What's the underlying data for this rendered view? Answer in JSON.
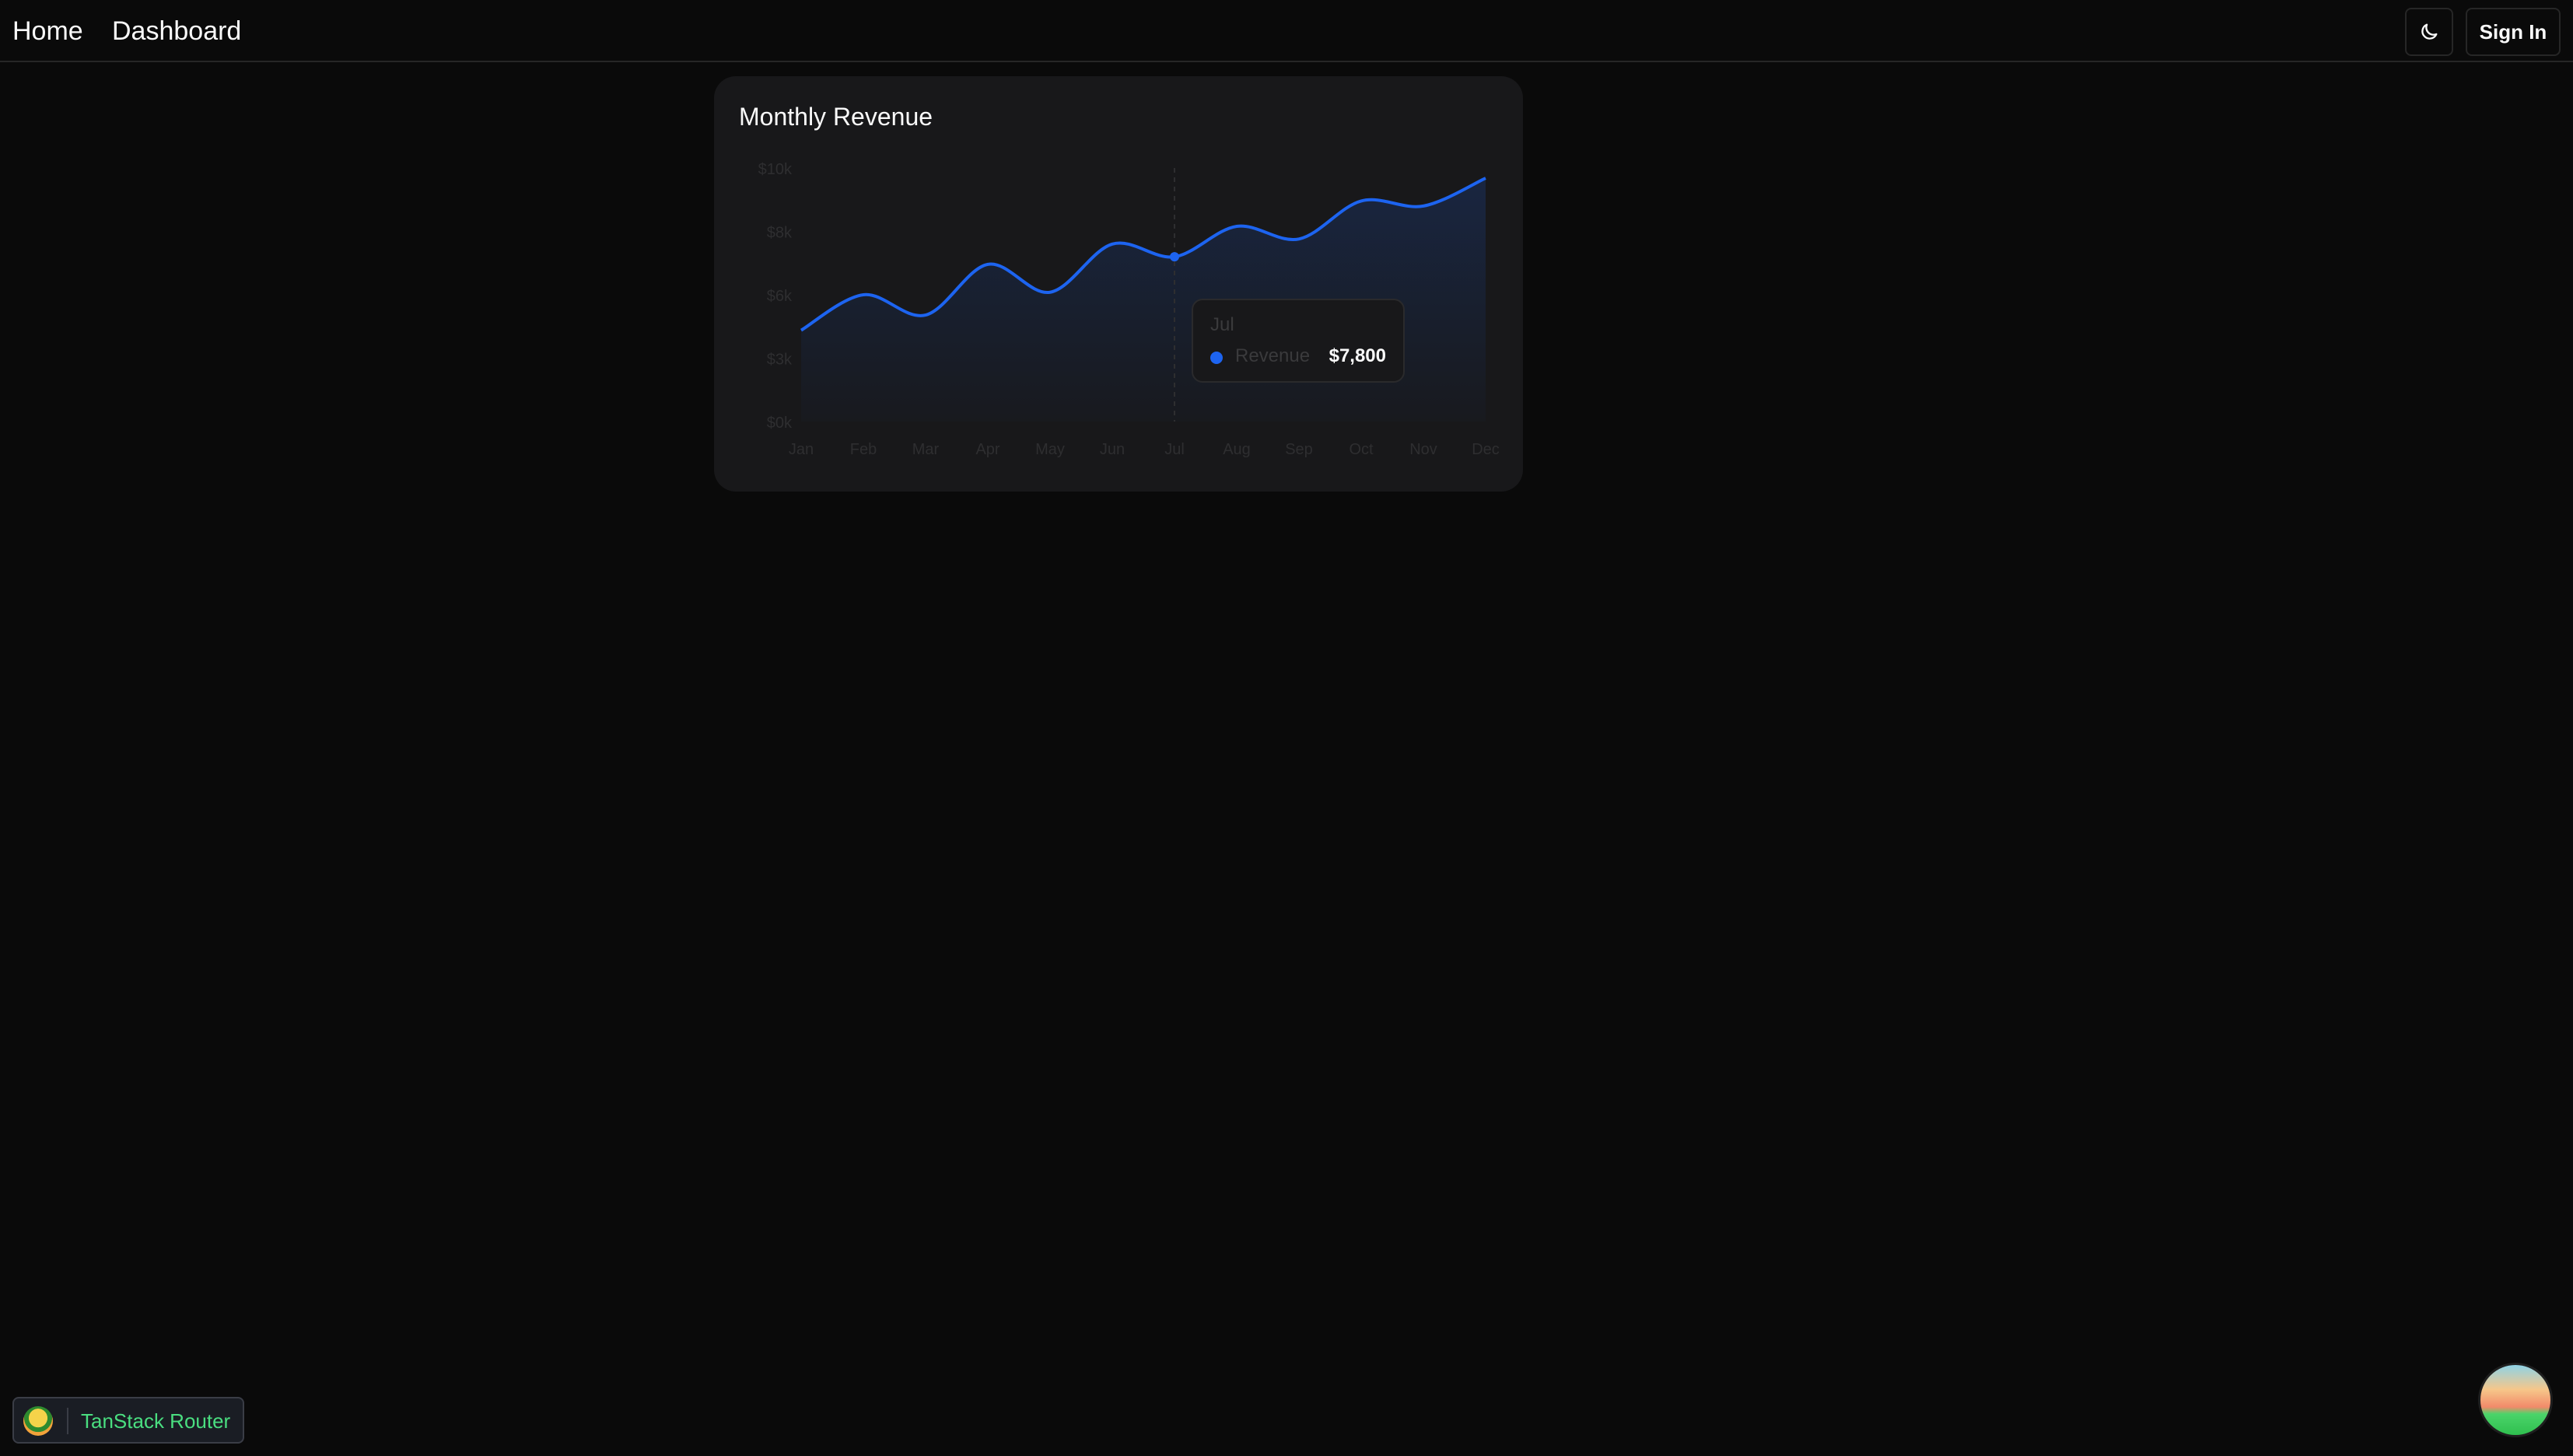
{
  "nav": {
    "home_label": "Home",
    "dashboard_label": "Dashboard",
    "theme_toggle_icon": "moon-icon",
    "signin_label": "Sign In"
  },
  "card": {
    "title": "Monthly Revenue"
  },
  "tooltip": {
    "title": "Jul",
    "series_name": "Revenue",
    "value": "$7,800",
    "color": "#1d64f0"
  },
  "devtools": {
    "label": "TanStack Router",
    "logo_icon": "tanstack-logo-icon",
    "fab_icon": "tanstack-query-logo-icon"
  },
  "chart_data": {
    "type": "area",
    "title": "Monthly Revenue",
    "x": [
      "Jan",
      "Feb",
      "Mar",
      "Apr",
      "May",
      "Jun",
      "Jul",
      "Aug",
      "Sep",
      "Oct",
      "Nov",
      "Dec"
    ],
    "yticks": [
      "$10k",
      "$8k",
      "$6k",
      "$3k",
      "$0k"
    ],
    "ylim": [
      0,
      10000
    ],
    "series": [
      {
        "name": "Revenue",
        "values": [
          3600,
          5000,
          4200,
          6200,
          5100,
          7000,
          6500,
          7700,
          7200,
          8700,
          8500,
          9600
        ],
        "color": "#1d64f0"
      }
    ],
    "highlight_index": 6,
    "grid": false
  }
}
